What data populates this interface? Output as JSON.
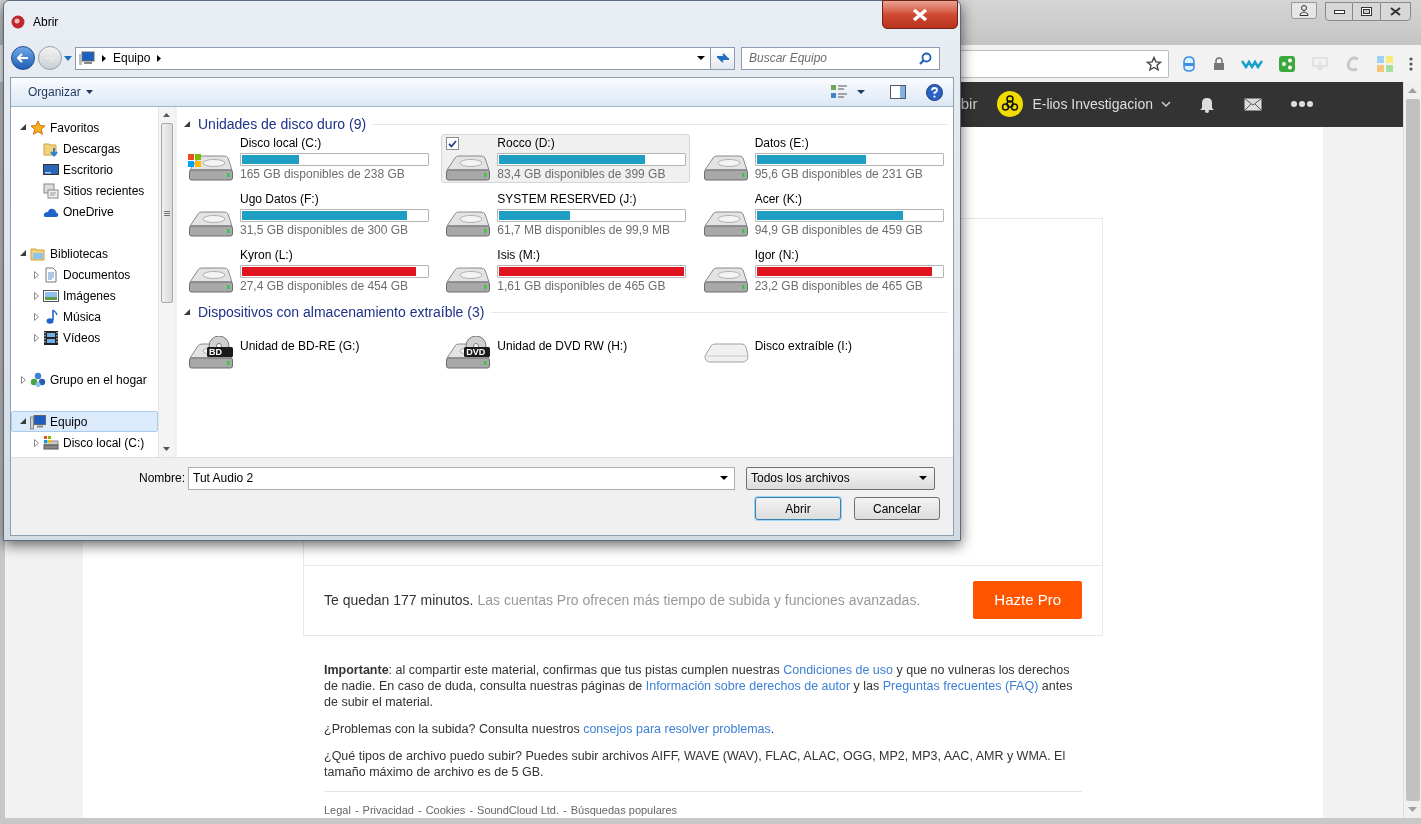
{
  "dialog": {
    "title": "Abrir",
    "breadcrumb": [
      "Equipo"
    ],
    "search_placeholder": "Buscar Equipo",
    "organize": "Organizar",
    "sidebar": [
      {
        "label": "Favoritos",
        "kind": "star",
        "expanded": true,
        "selected": false,
        "children": [
          {
            "label": "Descargas",
            "kind": "downloads",
            "selected": false
          },
          {
            "label": "Escritorio",
            "kind": "desktop",
            "selected": false
          },
          {
            "label": "Sitios recientes",
            "kind": "recent",
            "selected": false
          },
          {
            "label": "OneDrive",
            "kind": "cloud",
            "selected": false
          }
        ]
      },
      {
        "label": "Bibliotecas",
        "kind": "library",
        "expanded": true,
        "selected": false,
        "children": [
          {
            "label": "Documentos",
            "kind": "document",
            "expanded": false,
            "selected": false
          },
          {
            "label": "Imágenes",
            "kind": "pictures",
            "expanded": false,
            "selected": false
          },
          {
            "label": "Música",
            "kind": "music",
            "expanded": false,
            "selected": false
          },
          {
            "label": "Vídeos",
            "kind": "videos",
            "expanded": false,
            "selected": false
          }
        ]
      },
      {
        "label": "Grupo en el hogar",
        "kind": "homegroup",
        "expanded": false,
        "selected": false
      },
      {
        "label": "Equipo",
        "kind": "computer",
        "expanded": true,
        "selected": true,
        "children": [
          {
            "label": "Disco local (C:)",
            "kind": "drive",
            "expanded": false,
            "selected": false
          }
        ]
      }
    ],
    "groups": [
      {
        "title": "Unidades de disco duro (9)",
        "expanded": true,
        "items": [
          {
            "name": "Disco local (C:)",
            "kind": "system",
            "free": "165 GB disponibles de 238 GB",
            "level": 0.31,
            "color": "#1f9ec4",
            "selected": false
          },
          {
            "name": "Rocco (D:)",
            "kind": "hdd",
            "free": "83,4 GB disponibles de 399 GB",
            "level": 0.79,
            "color": "#1f9ec4",
            "selected": true
          },
          {
            "name": "Datos (E:)",
            "kind": "hdd",
            "free": "95,6 GB disponibles de 231 GB",
            "level": 0.59,
            "color": "#1f9ec4",
            "selected": false
          },
          {
            "name": "Ugo Datos (F:)",
            "kind": "hdd",
            "free": "31,5 GB disponibles de 300 GB",
            "level": 0.89,
            "color": "#1f9ec4",
            "selected": false
          },
          {
            "name": "SYSTEM RESERVED (J:)",
            "kind": "hdd",
            "free": "61,7 MB disponibles de 99,9 MB",
            "level": 0.38,
            "color": "#1f9ec4",
            "selected": false
          },
          {
            "name": "Acer (K:)",
            "kind": "hdd",
            "free": "94,9 GB disponibles de 459 GB",
            "level": 0.79,
            "color": "#1f9ec4",
            "selected": false
          },
          {
            "name": "Kyron (L:)",
            "kind": "hdd",
            "free": "27,4 GB disponibles de 454 GB",
            "level": 0.94,
            "color": "#e0141e",
            "selected": false
          },
          {
            "name": "Isis (M:)",
            "kind": "hdd",
            "free": "1,61 GB disponibles de 465 GB",
            "level": 0.997,
            "color": "#e0141e",
            "selected": false
          },
          {
            "name": "Igor (N:)",
            "kind": "hdd",
            "free": "23,2 GB disponibles de 465 GB",
            "level": 0.95,
            "color": "#e0141e",
            "selected": false
          }
        ]
      },
      {
        "title": "Dispositivos con almacenamiento extraíble (3)",
        "expanded": true,
        "items": [
          {
            "name": "Unidad de BD-RE (G:)",
            "kind": "disc",
            "badge": "BD",
            "selected": false
          },
          {
            "name": "Unidad de DVD RW (H:)",
            "kind": "disc",
            "badge": "DVD",
            "selected": false
          },
          {
            "name": "Disco extraíble (I:)",
            "kind": "removable",
            "selected": false
          }
        ]
      }
    ],
    "file_name": {
      "label": "Nombre:",
      "value": "Tut Audio 2"
    },
    "filter": "Todos los archivos",
    "buttons": [
      {
        "label": "Abrir",
        "default": true
      },
      {
        "label": "Cancelar",
        "default": false
      }
    ]
  },
  "browser": {
    "nav": {
      "cut_item": "bir",
      "account": "E-lios Investigacion"
    },
    "promo": {
      "minutes": "Te quedan 177 minutos.",
      "pitch": "Las cuentas Pro ofrecen más tiempo de subida y funciones avanzadas.",
      "button": "Hazte Pro"
    },
    "notes": [
      [
        {
          "kind": "text",
          "text": "**Importante**: al compartir este material, confirmas que tus pistas cumplen nuestras "
        },
        {
          "kind": "link",
          "text": "Condiciones de uso"
        },
        {
          "kind": "text",
          "text": " y que no vulneras los derechos de nadie. En caso de duda, consulta nuestras páginas de "
        },
        {
          "kind": "link",
          "text": "Información sobre derechos de autor"
        },
        {
          "kind": "text",
          "text": " y las "
        },
        {
          "kind": "link",
          "text": "Preguntas frecuentes (FAQ)"
        },
        {
          "kind": "text",
          "text": " antes de subir el material."
        }
      ],
      [
        {
          "kind": "text",
          "text": "¿Problemas con la subida? Consulta nuestros "
        },
        {
          "kind": "link",
          "text": "consejos para resolver problemas"
        },
        {
          "kind": "text",
          "text": "."
        }
      ],
      [
        {
          "kind": "text",
          "text": "¿Qué tipos de archivo puedo subir? Puedes subir archivos AIFF, WAVE (WAV), FLAC, ALAC, OGG, MP2, MP3, AAC, AMR y WMA. El tamaño máximo de archivo es de 5 GB."
        }
      ]
    ],
    "footer": {
      "links": [
        "Legal",
        "Privacidad",
        "Cookies",
        "SoundCloud Ltd.",
        "Búsquedas populares"
      ],
      "separator": "-"
    }
  }
}
